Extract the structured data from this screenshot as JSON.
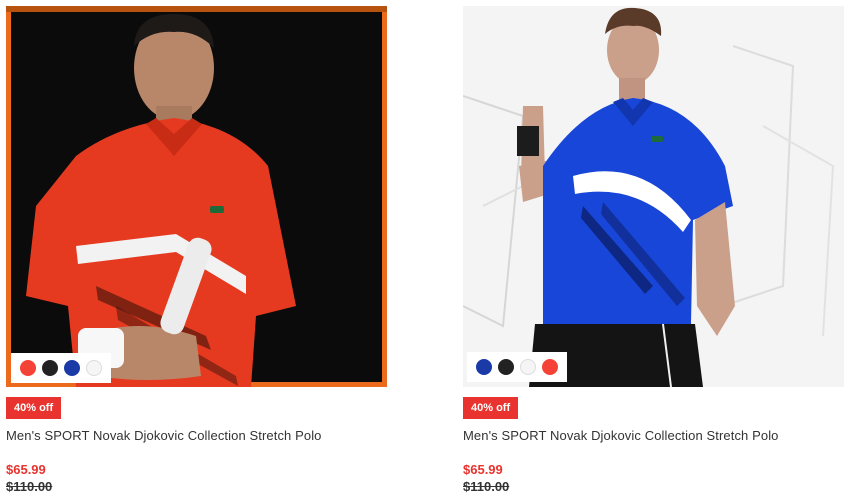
{
  "products": [
    {
      "badge": "40% off",
      "title": "Men's SPORT Novak Djokovic Collection Stretch Polo",
      "price": "$65.99",
      "old_price": "$110.00",
      "image_alt": "Novak Djokovic wearing red stretch polo",
      "swatches": [
        "#f44336",
        "#222222",
        "#1a3aa8",
        "#f5f5f5"
      ]
    },
    {
      "badge": "40% off",
      "title": "Men's SPORT Novak Djokovic Collection Stretch Polo",
      "price": "$65.99",
      "old_price": "$110.00",
      "image_alt": "Model wearing blue stretch polo",
      "swatches": [
        "#1a3aa8",
        "#222222",
        "#f5f5f5",
        "#f44336"
      ]
    }
  ],
  "colors": {
    "sale_red": "#e8332e",
    "text": "#333333",
    "frame_orange": "#ec6a1c"
  }
}
